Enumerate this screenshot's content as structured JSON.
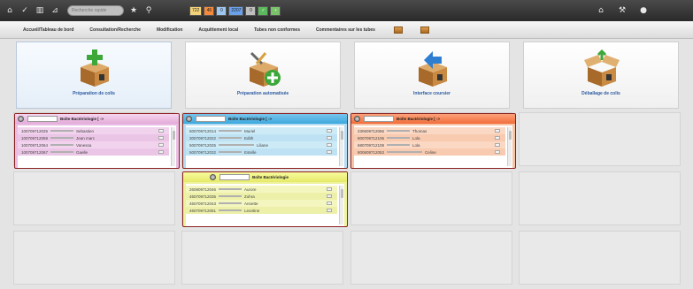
{
  "topbar": {
    "icons_left": [
      "home-icon",
      "check-icon",
      "document-icon",
      "chart-icon"
    ],
    "search_placeholder": "Recherche rapide",
    "star_icon": "★",
    "search_icon": "⚲",
    "badges": [
      {
        "value": "722",
        "color": "#f4d27a"
      },
      {
        "value": "46",
        "color": "#f58a3c"
      },
      {
        "value": "0",
        "color": "#9dc6f0"
      },
      {
        "value": "2207",
        "color": "#6aa1e8"
      },
      {
        "value": "0",
        "color": "#bfbfbf"
      },
      {
        "value": "✓",
        "color": "#5cb85c"
      },
      {
        "value": "▪",
        "color": "#7ac36a"
      }
    ],
    "icons_right": [
      "bell-icon",
      "wrench-icon",
      "user-icon"
    ]
  },
  "nav": {
    "items": [
      "Accueil/Tableau de bord",
      "Consultation/Recherche",
      "Modification",
      "Acquittement local",
      "Tubes non conformes",
      "Commentaires sur les tubes"
    ]
  },
  "tiles": [
    {
      "label": "Préparation de colis",
      "icon": "box-add-icon"
    },
    {
      "label": "Préparation automatisée",
      "icon": "box-tools-icon"
    },
    {
      "label": "Interface coursier",
      "icon": "box-transfer-icon"
    },
    {
      "label": "Déballage de colis",
      "icon": "box-open-icon"
    }
  ],
  "boxes": [
    {
      "title": "Boîte Bactériologie [ ->",
      "color": "pink",
      "rows": [
        {
          "code": "100709712025",
          "name": "Sebastien"
        },
        {
          "code": "100709712059",
          "name": "Jean marc"
        },
        {
          "code": "100709712064",
          "name": "Vanessa"
        },
        {
          "code": "100709712067",
          "name": "Gaelle"
        }
      ]
    },
    {
      "title": "Boîte Bactériologie [ ->",
      "color": "blue",
      "rows": [
        {
          "code": "500709712014",
          "name": "Muriel"
        },
        {
          "code": "300709712022",
          "name": "Edith"
        },
        {
          "code": "500709712025",
          "name": "Liliane"
        },
        {
          "code": "500709712032",
          "name": "Estelle"
        }
      ]
    },
    {
      "title": "Boîte Bactériologie [ ->",
      "color": "orange",
      "rows": [
        {
          "code": "230609712066",
          "name": "Thomas"
        },
        {
          "code": "800709712106",
          "name": "Lola"
        },
        {
          "code": "680709712108",
          "name": "Lola"
        },
        {
          "code": "800609712053",
          "name": "Celine"
        }
      ]
    },
    {
      "title": "Boîte Bactériologie",
      "color": "yellow",
      "rows": [
        {
          "code": "260809712046",
          "name": "Aurore"
        },
        {
          "code": "460709712035",
          "name": "Zohra"
        },
        {
          "code": "460709712043",
          "name": "Annette"
        },
        {
          "code": "460709712051",
          "name": "Leontine"
        }
      ]
    }
  ]
}
